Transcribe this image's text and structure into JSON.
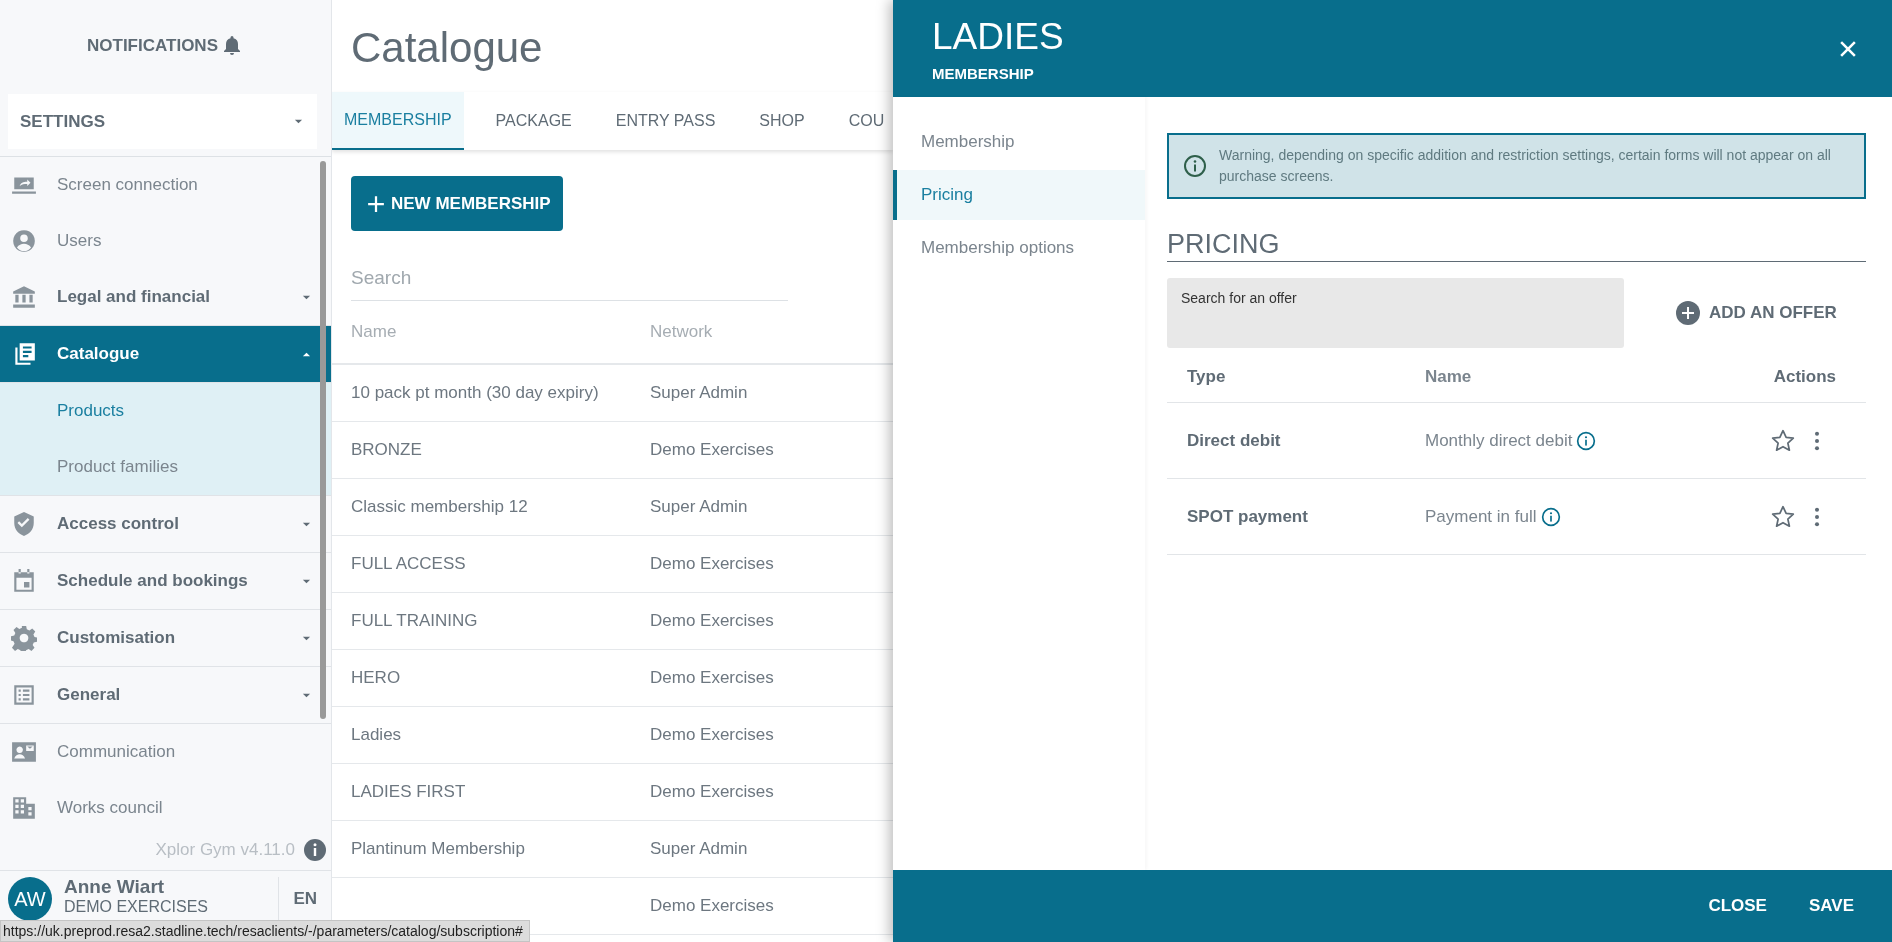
{
  "sidebar": {
    "notifications": "NOTIFICATIONS",
    "settings_menu": {
      "value": "SETTINGS"
    },
    "items": [
      {
        "label": "Screen connection",
        "kind": "link",
        "selected": false
      },
      {
        "label": "Users",
        "kind": "link",
        "selected": false
      },
      {
        "label": "Legal and financial",
        "kind": "group",
        "expanded": false,
        "selected": false
      },
      {
        "label": "Catalogue",
        "kind": "group",
        "expanded": true,
        "selected": true,
        "children": [
          {
            "label": "Products",
            "selected": true
          },
          {
            "label": "Product families",
            "selected": false
          }
        ]
      },
      {
        "label": "Access control",
        "kind": "group",
        "expanded": false,
        "selected": false
      },
      {
        "label": "Schedule and bookings",
        "kind": "group",
        "expanded": false,
        "selected": false
      },
      {
        "label": "Customisation",
        "kind": "group",
        "expanded": false,
        "selected": false
      },
      {
        "label": "General",
        "kind": "group",
        "expanded": false,
        "selected": false
      },
      {
        "label": "Communication",
        "kind": "link",
        "selected": false
      },
      {
        "label": "Works council",
        "kind": "link",
        "selected": false
      }
    ],
    "version": "Xplor Gym v4.11.0",
    "user": {
      "initials": "AW",
      "name": "Anne Wiart",
      "organisation": "DEMO EXERCISES",
      "language": "EN"
    }
  },
  "main": {
    "title": "Catalogue",
    "tabs": [
      {
        "label": "MEMBERSHIP",
        "selected": true
      },
      {
        "label": "PACKAGE",
        "selected": false
      },
      {
        "label": "ENTRY PASS",
        "selected": false
      },
      {
        "label": "SHOP",
        "selected": false
      },
      {
        "label": "COU",
        "selected": false
      }
    ],
    "new_button": "NEW MEMBERSHIP",
    "search": {
      "placeholder": "Search"
    },
    "table": {
      "columns": [
        "Name",
        "Network"
      ],
      "rows": [
        {
          "name": "10 pack pt month (30 day expiry)",
          "network": "Super Admin"
        },
        {
          "name": "BRONZE",
          "network": "Demo Exercises"
        },
        {
          "name": "Classic membership 12",
          "network": "Super Admin"
        },
        {
          "name": "FULL ACCESS",
          "network": "Demo Exercises"
        },
        {
          "name": "FULL TRAINING",
          "network": "Demo Exercises"
        },
        {
          "name": "HERO",
          "network": "Demo Exercises"
        },
        {
          "name": "Ladies",
          "network": "Demo Exercises"
        },
        {
          "name": "LADIES FIRST",
          "network": "Demo Exercises"
        },
        {
          "name": "Plantinum Membership",
          "network": "Super Admin"
        },
        {
          "network": "Demo Exercises"
        }
      ]
    }
  },
  "panel": {
    "title": "LADIES",
    "subtitle": "MEMBERSHIP",
    "nav": [
      {
        "label": "Membership",
        "selected": false
      },
      {
        "label": "Pricing",
        "selected": true
      },
      {
        "label": "Membership options",
        "selected": false
      }
    ],
    "warning": "Warning, depending on specific addition and restriction settings, certain forms will not appear on all purchase screens.",
    "section_title": "PRICING",
    "offer_search": {
      "placeholder": "Search for an offer"
    },
    "add_button": "ADD AN OFFER",
    "offers": {
      "columns": [
        "Type",
        "Name",
        "Actions"
      ],
      "rows": [
        {
          "type": "Direct debit",
          "name": "Monthly direct debit",
          "starred": false
        },
        {
          "type": "SPOT payment",
          "name": "Payment in full",
          "starred": false
        }
      ]
    },
    "footer_buttons": [
      "CLOSE",
      "SAVE"
    ]
  },
  "status_bar": {
    "url": "https://uk.preprod.resa2.stadline.tech/resaclients/-/parameters/catalog/subscription#"
  }
}
